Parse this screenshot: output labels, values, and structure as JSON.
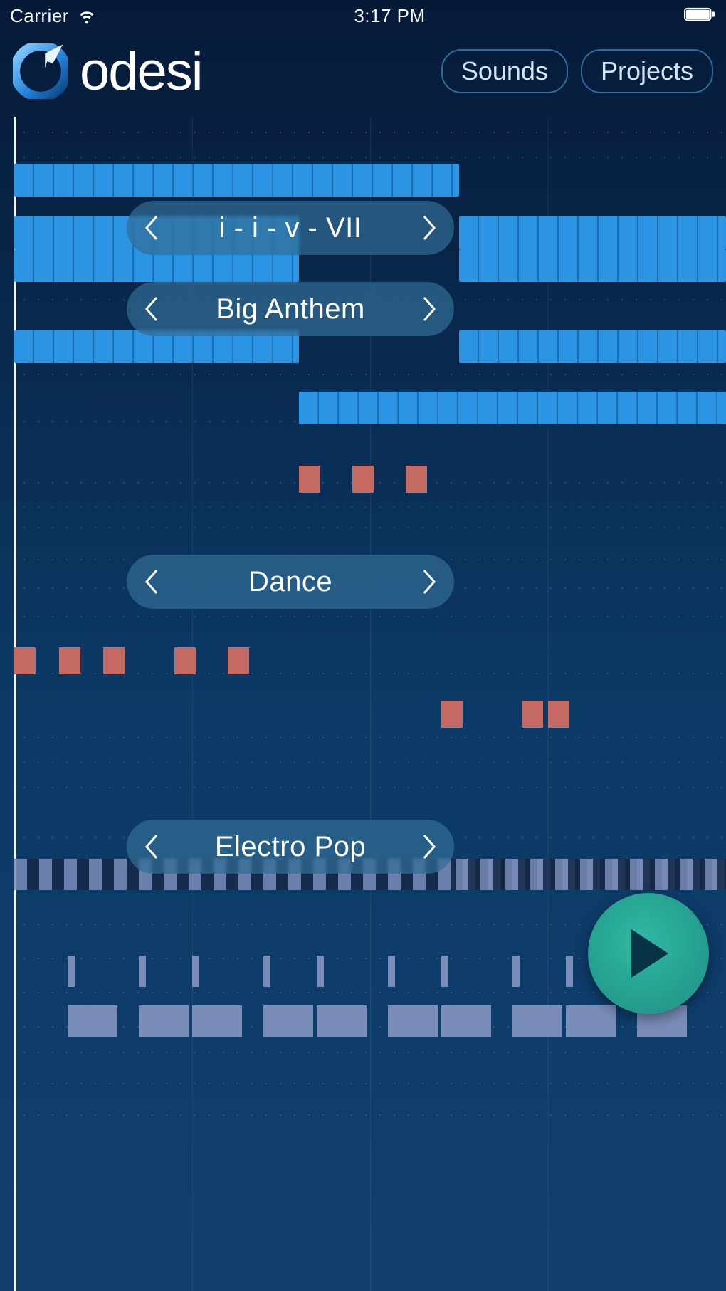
{
  "status": {
    "carrier": "Carrier",
    "time": "3:17 PM"
  },
  "header": {
    "app_name": "odesi",
    "sounds": "Sounds",
    "projects": "Projects"
  },
  "selectors": {
    "chord_progression": "i - i - v - VII",
    "preset": "Big Anthem",
    "genre": "Dance",
    "style": "Electro Pop"
  },
  "colors": {
    "note_blue": "#2b95e3",
    "block_red": "#c46a63",
    "lane_purple": "#7a8cb8",
    "play_green": "#2fb8a3"
  },
  "roll": {
    "bars": 4,
    "chord_tracks": [
      {
        "row": 0,
        "notes": [
          {
            "start": 0,
            "span": 2.5
          }
        ]
      },
      {
        "row": 1,
        "notes": [
          {
            "start": 0,
            "span": 1.6
          },
          {
            "start": 2.5,
            "span": 1.5
          }
        ]
      },
      {
        "row": 2,
        "notes": [
          {
            "start": 0,
            "span": 1.6
          },
          {
            "start": 2.5,
            "span": 1.5
          }
        ]
      },
      {
        "row": 3,
        "notes": [
          {
            "start": 0,
            "span": 1.6
          },
          {
            "start": 2.5,
            "span": 1.5
          }
        ]
      },
      {
        "row": 4,
        "notes": [
          {
            "start": 1.6,
            "span": 2.4
          }
        ]
      }
    ],
    "red_hits_1": [
      1.6,
      1.9,
      2.2
    ],
    "red_hits_2": [
      0.0,
      0.25,
      0.5,
      0.9,
      1.2
    ],
    "red_hits_3": [
      2.4,
      2.85,
      3.0
    ],
    "bass_ticks": [
      0.3,
      0.7,
      1.0,
      1.4,
      1.7,
      2.1,
      2.4,
      2.8,
      3.1,
      3.5
    ]
  }
}
